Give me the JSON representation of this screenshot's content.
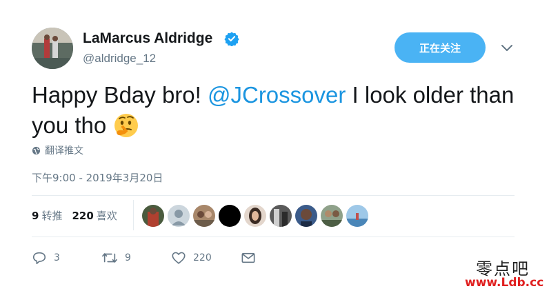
{
  "header": {
    "display_name": "LaMarcus Aldridge",
    "handle": "@aldridge_12",
    "follow_label": "正在关注",
    "accent_color": "#4ab3f4"
  },
  "tweet": {
    "text_before": "Happy Bday bro! ",
    "mention": "@JCrossover",
    "text_after": " I look older than you tho",
    "emoji": "thinking-face",
    "translate_label": "翻译推文",
    "timestamp": "下午9:00 - 2019年3月20日"
  },
  "stats": {
    "retweets_count": "9",
    "retweets_label": "转推",
    "likes_count": "220",
    "likes_label": "喜欢",
    "liker_avatar_count": 9
  },
  "actions": {
    "reply_count": "3",
    "retweet_count": "9",
    "like_count": "220",
    "icons": [
      "reply-icon",
      "retweet-icon",
      "like-icon",
      "message-icon"
    ]
  },
  "watermark": {
    "chinese": "零点吧",
    "url": "www.Ldb.cc"
  }
}
